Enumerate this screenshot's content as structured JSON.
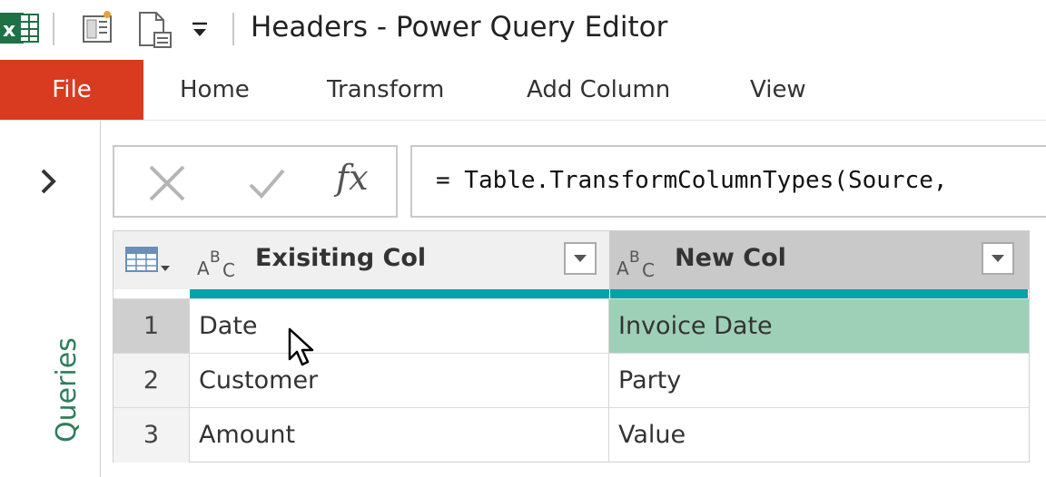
{
  "window": {
    "title": "Headers - Power Query Editor"
  },
  "ribbon": {
    "tabs": [
      "File",
      "Home",
      "Transform",
      "Add Column",
      "View"
    ]
  },
  "queries_pane": {
    "label": "Queries",
    "expand_icon": "chevron-right-icon"
  },
  "formula_bar": {
    "cancel_icon": "close-icon",
    "confirm_icon": "checkmark-icon",
    "fx_label": "fx",
    "formula": "= Table.TransformColumnTypes(Source,"
  },
  "grid": {
    "columns": [
      {
        "type_label": "ABC",
        "name": "Exisiting Col"
      },
      {
        "type_label": "ABC",
        "name": "New Col"
      }
    ],
    "rows": [
      {
        "num": "1",
        "c1": "Date",
        "c2": "Invoice Date"
      },
      {
        "num": "2",
        "c1": "Customer",
        "c2": "Party"
      },
      {
        "num": "3",
        "c1": "Amount",
        "c2": "Value"
      }
    ],
    "selected_row": "1"
  },
  "colors": {
    "file_tab": "#d83b1f",
    "teal_bar": "#00a3a8",
    "highlight_cell": "#9ed0b7",
    "queries_text": "#2f7d5a"
  }
}
